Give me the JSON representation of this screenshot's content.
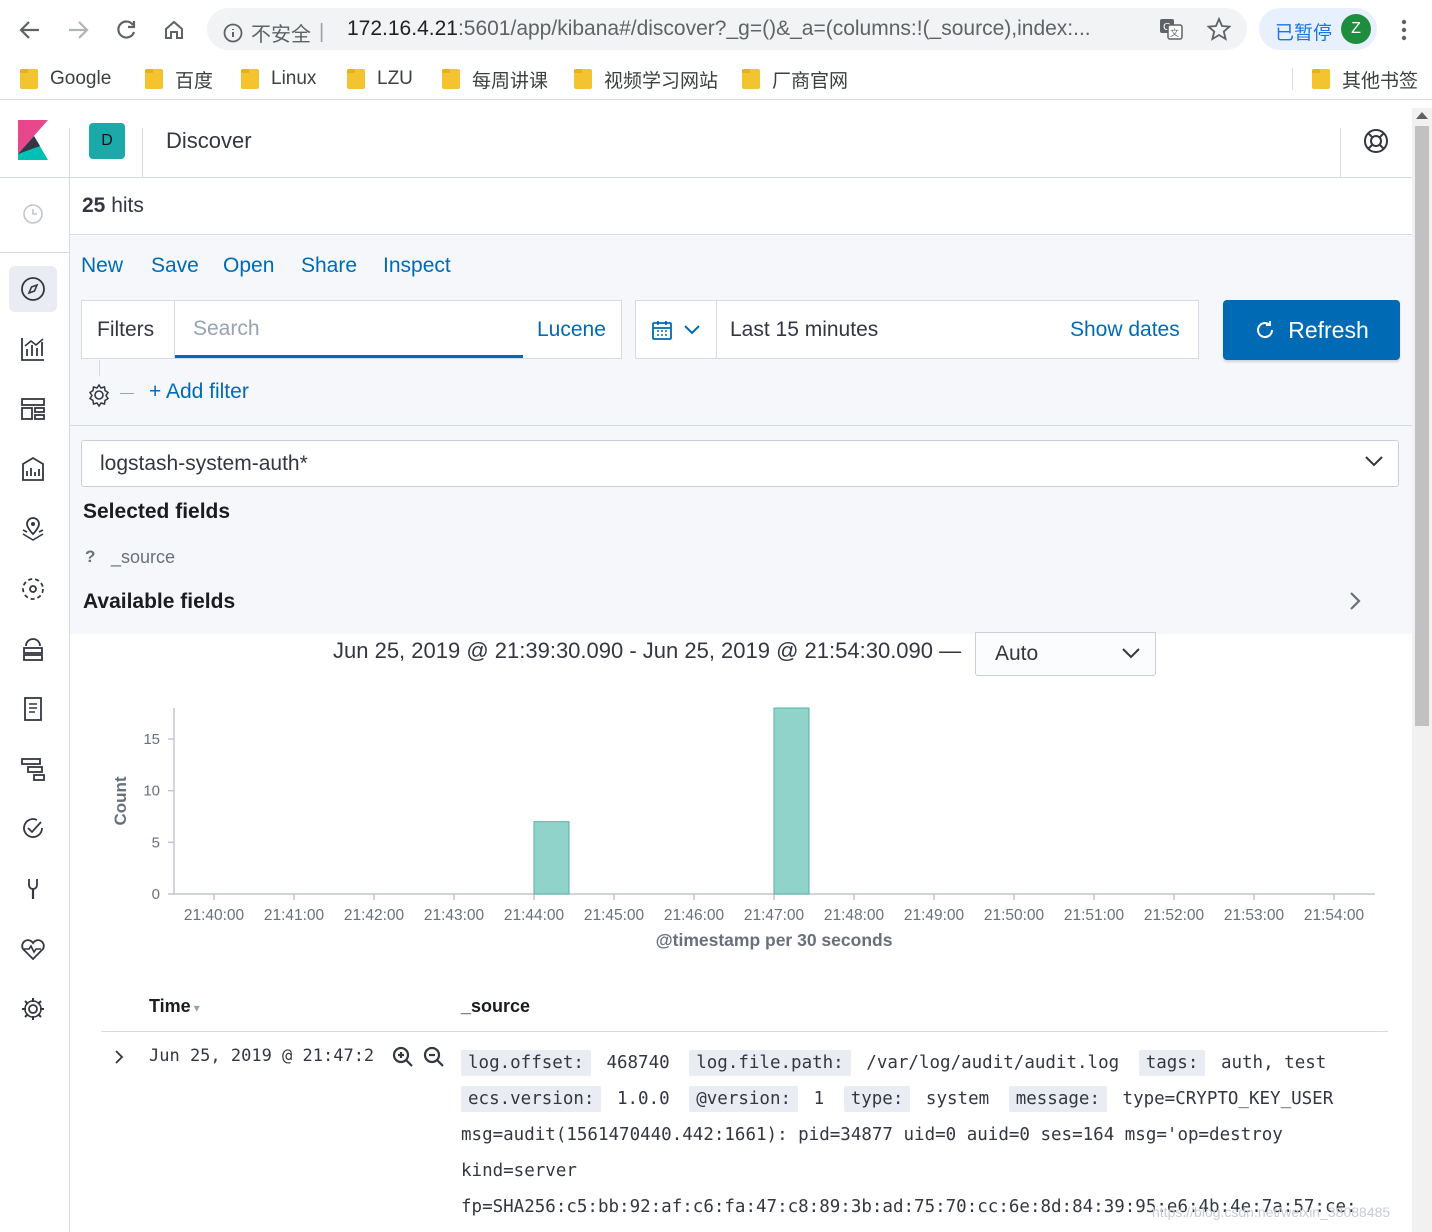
{
  "browser": {
    "insecure_label": "不安全",
    "url_host": "172.16.4.21",
    "url_rest": ":5601/app/kibana#/discover?_g=()&_a=(columns:!(_source),index:...",
    "paused_label": "已暂停",
    "profile_initial": "Z"
  },
  "bookmarks": [
    "Google",
    "百度",
    "Linux",
    "LZU",
    "每周讲课",
    "视频学习网站",
    "厂商官网"
  ],
  "other_bookmarks": "其他书签",
  "kibana": {
    "space_initial": "D",
    "app_title": "Discover",
    "hits_count": "25",
    "hits_label": " hits",
    "top_nav": {
      "new": "New",
      "save": "Save",
      "open": "Open",
      "share": "Share",
      "inspect": "Inspect"
    },
    "filters_label": "Filters",
    "search_placeholder": "Search",
    "lucene_label": "Lucene",
    "date_range": "Last 15 minutes",
    "show_dates": "Show dates",
    "refresh_label": "Refresh",
    "add_filter": "+ Add filter",
    "index_pattern": "logstash-system-auth*",
    "selected_fields_title": "Selected fields",
    "selected_fields": [
      {
        "type": "?",
        "name": "_source"
      }
    ],
    "available_fields_title": "Available fields",
    "time_range_text": "Jun 25, 2019 @ 21:39:30.090 - Jun 25, 2019 @ 21:54:30.090 —",
    "interval": "Auto",
    "accent": "#006bb4",
    "bar_color": "#90d3cb"
  },
  "chart_data": {
    "type": "bar",
    "xlabel": "@timestamp per 30 seconds",
    "ylabel": "Count",
    "x_ticks": [
      "21:40:00",
      "21:41:00",
      "21:42:00",
      "21:43:00",
      "21:44:00",
      "21:45:00",
      "21:46:00",
      "21:47:00",
      "21:48:00",
      "21:49:00",
      "21:50:00",
      "21:51:00",
      "21:52:00",
      "21:53:00",
      "21:54:00"
    ],
    "y_ticks": [
      0,
      5,
      10,
      15
    ],
    "ylim": [
      0,
      18
    ],
    "bars": [
      {
        "x": "21:44:00",
        "value": 7
      },
      {
        "x": "21:47:00",
        "value": 18
      }
    ]
  },
  "table": {
    "col_time": "Time",
    "col_source": "_source",
    "rows": [
      {
        "time": "Jun 25, 2019 @ 21:47:2",
        "fields": [
          {
            "k": "log.offset:",
            "v": "468740"
          },
          {
            "k": "log.file.path:",
            "v": "/var/log/audit/audit.log"
          },
          {
            "k": "tags:",
            "v": "auth, test"
          },
          {
            "k": "ecs.version:",
            "v": "1.0.0"
          },
          {
            "k": "@version:",
            "v": "1"
          },
          {
            "k": "type:",
            "v": "system"
          },
          {
            "k": "message:",
            "v": "type=CRYPTO_KEY_USER msg=audit(1561470440.442:1661): pid=34877 uid=0 auid=0 ses=164 msg='op=destroy kind=server fp=SHA256:c5:bb:92:af:c6:fa:47:c8:89:3b:ad:75:70:cc:6e:8d:84:39:95:e6:4b:4e:7a:57:ce:"
          }
        ]
      }
    ]
  },
  "watermark": "https://blog.csdn.net/weixin_38088485"
}
